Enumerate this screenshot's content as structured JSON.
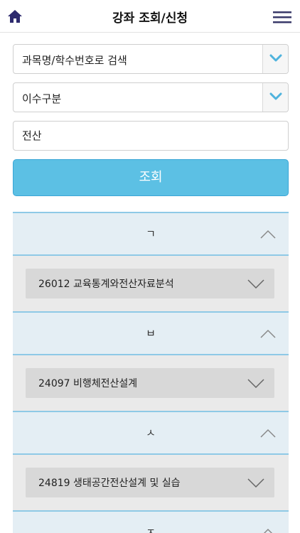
{
  "header": {
    "title": "강좌 조회/신청",
    "home_icon": "home-icon",
    "menu_icon": "hamburger-menu-icon"
  },
  "form": {
    "search_type": {
      "value": "과목명/학수번호로 검색"
    },
    "category": {
      "value": "이수구분"
    },
    "keyword": {
      "value": "전산"
    },
    "search_button": "조회"
  },
  "groups": [
    {
      "letter": "ㄱ",
      "course": "26012 교육통계와전산자료분석"
    },
    {
      "letter": "ㅂ",
      "course": "24097 비행체전산설계"
    },
    {
      "letter": "ㅅ",
      "course": "24819 생태공간전산설계 및 실습"
    },
    {
      "letter": "ㅈ"
    }
  ],
  "colors": {
    "accent": "#5cc0e4",
    "group_header_bg": "#e4eef4",
    "divider": "#8ec9e6",
    "body_bg": "#eaeaea",
    "item_bg": "#d8d8d8"
  }
}
